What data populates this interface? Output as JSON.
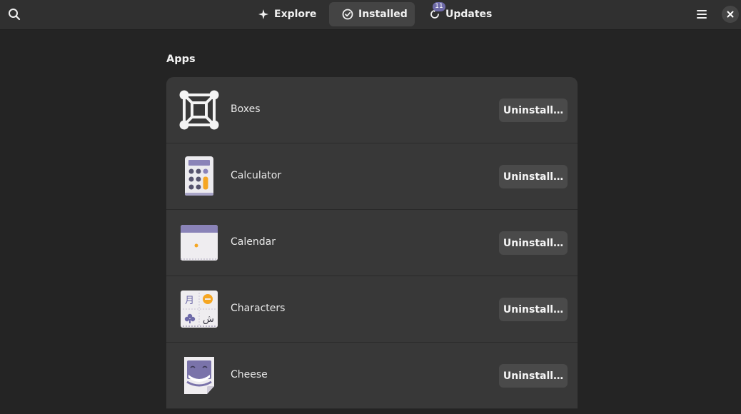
{
  "header": {
    "search_icon": "search-icon",
    "tabs": [
      {
        "label": "Explore",
        "icon": "explore-icon",
        "active": false
      },
      {
        "label": "Installed",
        "icon": "installed-check-icon",
        "active": true
      },
      {
        "label": "Updates",
        "icon": "updates-refresh-icon",
        "active": false,
        "badge": "11"
      }
    ],
    "menu_icon": "hamburger-menu-icon",
    "close_icon": "close-icon"
  },
  "main": {
    "section_title": "Apps",
    "apps": [
      {
        "name": "Boxes",
        "icon": "boxes-app-icon",
        "action": "Uninstall…"
      },
      {
        "name": "Calculator",
        "icon": "calculator-app-icon",
        "action": "Uninstall…"
      },
      {
        "name": "Calendar",
        "icon": "calendar-app-icon",
        "action": "Uninstall…"
      },
      {
        "name": "Characters",
        "icon": "characters-app-icon",
        "action": "Uninstall…"
      },
      {
        "name": "Cheese",
        "icon": "cheese-app-icon",
        "action": "Uninstall…"
      }
    ]
  },
  "colors": {
    "window_bg": "#242424",
    "headerbar_bg": "#303030",
    "list_bg": "#383838",
    "button_bg": "#4a4a4a",
    "accent_purple": "#6e6aa8",
    "accent_orange": "#f5a623"
  }
}
